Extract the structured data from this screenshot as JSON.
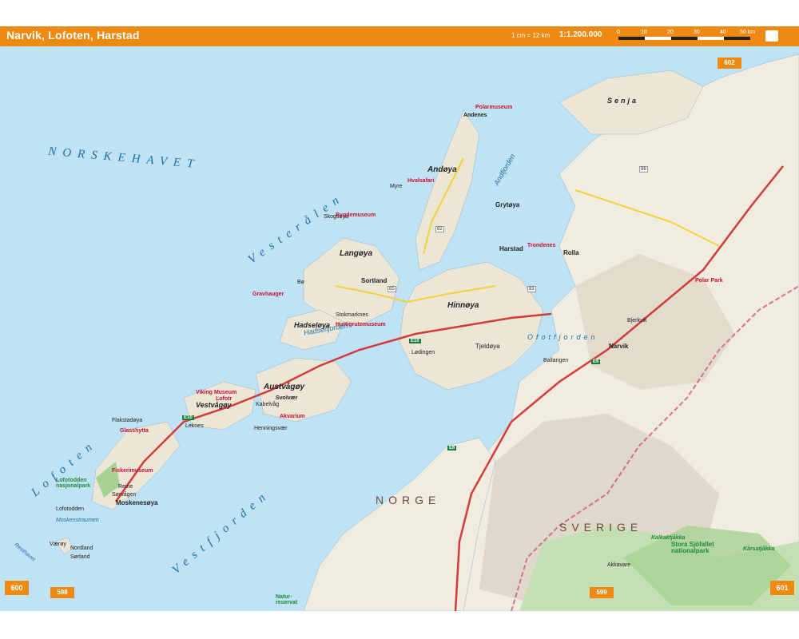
{
  "header": {
    "title": "Narvik, Lofoten, Harstad",
    "scale_text": "1 cm = 12 km",
    "scale_ratio": "1:1.200.000",
    "scale_ticks": [
      "0",
      "10",
      "20",
      "30",
      "40",
      "50 km"
    ],
    "book_icon": "book-icon"
  },
  "page_numbers": {
    "left": "600",
    "right": "601",
    "prev_left": "598",
    "bottom_center": "599",
    "top_right": "602"
  },
  "seas": {
    "norskehavet": "NORSKEHAVET",
    "vesteralen": "Vesterålen",
    "lofoten": "Lofoten",
    "vestfjorden": "Vestfjorden",
    "ofotfjorden": "Ofotfjorden",
    "andfjorden": "Andfjorden",
    "hadselfjorden": "Hadselfjorden",
    "moskenstraumen": "Moskenstraumen",
    "resthavet": "Resthavet"
  },
  "countries": {
    "norge": "NORGE",
    "sverige": "SVERIGE"
  },
  "islands": {
    "andoya": "Andøya",
    "langoya": "Langøya",
    "hadseloya": "Hadseløya",
    "austvagoy": "Austvågøy",
    "vestvagoy": "Vestvågøy",
    "flakstadoya": "Flakstadøya",
    "moskenesoya": "Moskenesøya",
    "hinnoya": "Hinnøya",
    "senja": "Senja",
    "tjeldoya": "Tjeldøya",
    "rolla": "Rolla",
    "grytoya": "Grytøya",
    "skogsoya": "Skogsøya",
    "vaeroy": "Værøy"
  },
  "towns": {
    "andenes": "Andenes",
    "harstad": "Harstad",
    "sortland": "Sortland",
    "narvik": "Narvik",
    "svolvaer": "Svolvær",
    "lodingen": "Lødingen",
    "bo": "Bø",
    "stokmarknes": "Stokmarknes",
    "leknes": "Leknes",
    "reine": "Reine",
    "sorvagen": "Sørvågen",
    "kabelvag": "Kabelvåg",
    "henningsvaer": "Henningsvær",
    "myre": "Myre",
    "bjerkvik": "Bjerkvik",
    "ballangen": "Ballangen",
    "lofotodden": "Lofotodden",
    "sorland": "Sørland",
    "nordland": "Nordland"
  },
  "sights": {
    "polarmuseum": "Polarmuseum",
    "hvalsafari": "Hvalsafari",
    "bygdemuseum": "Bygdemuseum",
    "viking_museum": "Viking Museum",
    "glasshytta": "Glasshytta",
    "fiskerimuseum": "Fiskerimuseum",
    "trondenes": "Trondenes",
    "polar_park": "Polar Park",
    "lofotr": "Lofotr",
    "akvarium": "Akvarium",
    "gravhauger": "Gravhauger",
    "hurtigrutemuseum": "Hurtigrutemuseum"
  },
  "parks": {
    "lofotodden_np": "Lofotodden nasjonalpark",
    "stora_sjofallet": "Stora Sjöfallet nationalpark",
    "kalkaktjakka": "Kalkaktjåkka",
    "karsattjakka": "Kårsatjåkka",
    "akkavare": "Akkavare",
    "natur_reservat": "Natur-reservat"
  },
  "routes": {
    "e10": "E10",
    "e6": "E6",
    "r82": "82",
    "r83": "83",
    "r85": "85",
    "r86": "86"
  },
  "colors": {
    "sea": "#bfe2f4",
    "land": "#f3f0e6",
    "mountain": "#d9d2c3",
    "forest": "#b8d9a8",
    "road_main": "#d23b3b",
    "road_secondary": "#f2d13a",
    "header": "#ee8a12",
    "border": "#c9577a"
  }
}
